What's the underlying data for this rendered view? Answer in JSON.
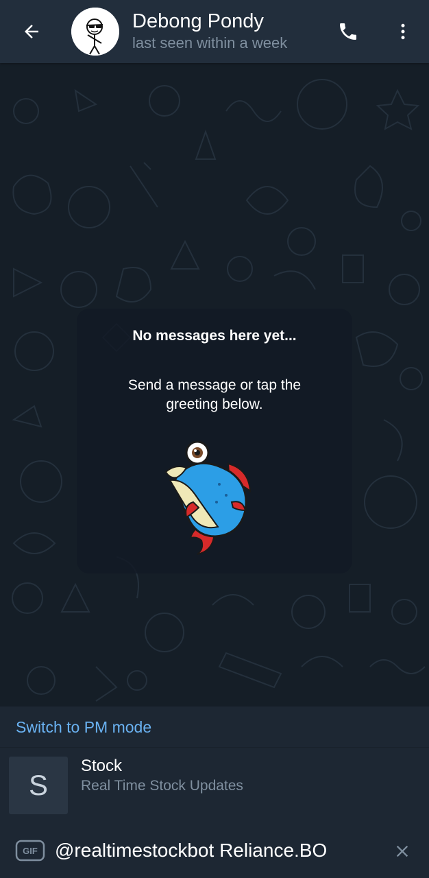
{
  "header": {
    "title": "Debong Pondy",
    "status": "last seen within a week",
    "back_icon": "arrow-left-icon",
    "call_icon": "phone-icon",
    "menu_icon": "more-vertical-icon"
  },
  "empty_state": {
    "title": "No messages here yet...",
    "text": "Send a message or tap the greeting below.",
    "sticker": "fish-sticker"
  },
  "inline_results": {
    "switch_pm": "Switch to PM mode",
    "items": [
      {
        "thumb_letter": "S",
        "title": "Stock",
        "description": "Real Time Stock Updates"
      }
    ]
  },
  "input": {
    "value": "@realtimestockbot Reliance.BO",
    "gif_label": "GIF",
    "clear_icon": "close-icon"
  },
  "colors": {
    "header_bg": "#222e3c",
    "chat_bg": "#151e27",
    "panel_bg": "#1d2733",
    "accent": "#6ab2f2",
    "secondary_text": "#7f8f9f"
  }
}
